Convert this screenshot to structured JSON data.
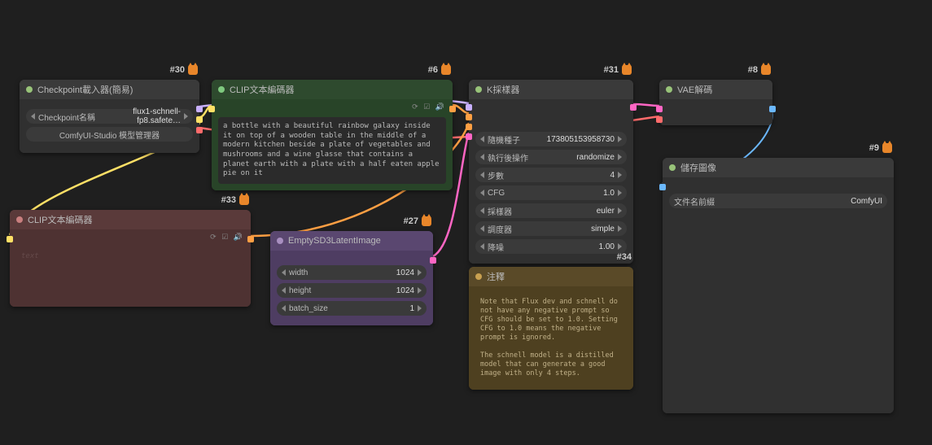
{
  "nodes": {
    "n30": {
      "id": "#30",
      "title": "Checkpoint載入器(簡易)",
      "ckpt_label": "Checkpoint名稱",
      "ckpt_value": "flux1-schnell-fp8.safete…",
      "manager_btn": "ComfyUI-Studio 模型管理器"
    },
    "n6": {
      "id": "#6",
      "title": "CLIP文本編碼器",
      "prompt": "a bottle with a beautiful rainbow galaxy inside it on top of a wooden table in the middle of a modern kitchen beside a plate of vegetables and mushrooms and a wine glasse that contains a planet earth with a plate with a half eaten apple pie on it"
    },
    "n33": {
      "id": "#33",
      "title": "CLIP文本編碼器",
      "prompt": "",
      "placeholder": "text"
    },
    "n27": {
      "id": "#27",
      "title": "EmptySD3LatentImage",
      "width_label": "width",
      "width_val": "1024",
      "height_label": "height",
      "height_val": "1024",
      "batch_label": "batch_size",
      "batch_val": "1"
    },
    "n31": {
      "id": "#31",
      "title": "K採樣器",
      "seed_label": "隨機種子",
      "seed_val": "173805153958730",
      "after_label": "執行後操作",
      "after_val": "randomize",
      "steps_label": "步數",
      "steps_val": "4",
      "cfg_label": "CFG",
      "cfg_val": "1.0",
      "sampler_label": "採樣器",
      "sampler_val": "euler",
      "scheduler_label": "調度器",
      "scheduler_val": "simple",
      "denoise_label": "降噪",
      "denoise_val": "1.00"
    },
    "n34": {
      "id": "#34",
      "title": "注釋",
      "note": "Note that Flux dev and schnell do not have any negative prompt so CFG should be set to 1.0. Setting CFG to 1.0 means the negative prompt is ignored.\n\nThe schnell model is a distilled model that can generate a good image with only 4 steps."
    },
    "n8": {
      "id": "#8",
      "title": "VAE解碼"
    },
    "n9": {
      "id": "#9",
      "title": "儲存圖像",
      "prefix_label": "文件名前綴",
      "prefix_val": "ComfyUI"
    }
  },
  "colors": {
    "model": "#c9b0ff",
    "clip": "#ffe066",
    "vae": "#ff6b6b",
    "conditioning": "#ff9f43",
    "latent": "#ff66c4",
    "image": "#6bb8ff"
  },
  "mini_icons": "⟳ ☑ 🔊"
}
